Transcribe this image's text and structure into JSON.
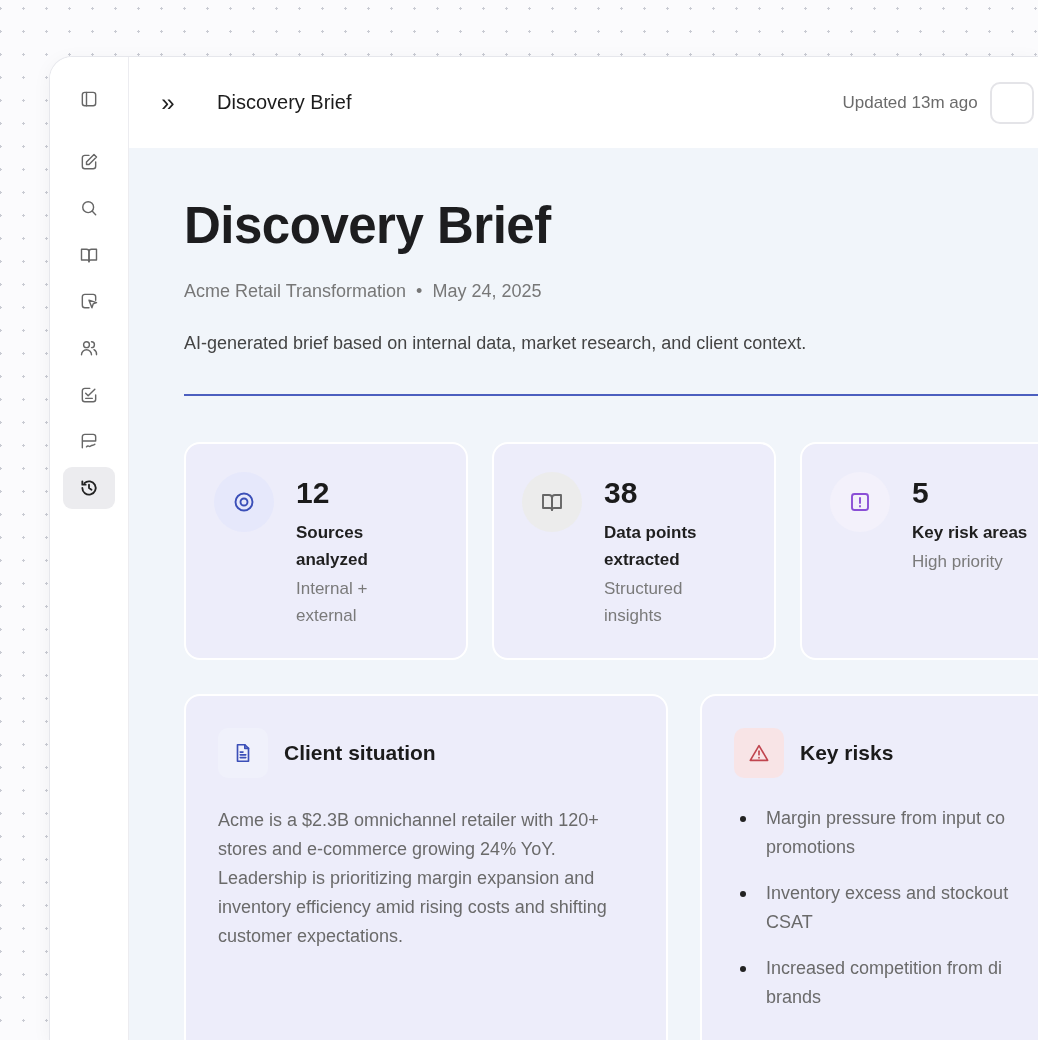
{
  "sidebar": {
    "items": [
      {
        "selected": false
      },
      {
        "selected": false
      },
      {
        "selected": false
      },
      {
        "selected": false
      },
      {
        "selected": false
      },
      {
        "selected": false
      },
      {
        "selected": false
      },
      {
        "selected": false
      },
      {
        "selected": true
      }
    ]
  },
  "header": {
    "expand": "»",
    "title": "Discovery Brief",
    "updated": "Updated 13m ago"
  },
  "brief": {
    "title": "Discovery Brief",
    "project": "Acme Retail Transformation",
    "separator": "•",
    "date": "May 24, 2025",
    "description": "AI-generated brief based on internal data, market research, and client context."
  },
  "stats": [
    {
      "kind": "sources",
      "value": "12",
      "label": "Sources analyzed",
      "note": "Internal + external"
    },
    {
      "kind": "datapoints",
      "value": "38",
      "label": "Data points extracted",
      "note": "Structured insights"
    },
    {
      "kind": "risks",
      "value": "5",
      "label": "Key risk areas",
      "note": "High priority"
    }
  ],
  "sections": [
    {
      "kind": "paragraph",
      "title": "Client situation",
      "text": "Acme is a $2.3B omnichannel retailer with 120+ stores and e-commerce growing 24% YoY. Leadership is prioritizing margin expansion and inventory efficiency amid rising costs and shifting customer expectations."
    },
    {
      "kind": "list",
      "title": "Key risks",
      "items": [
        {
          "lines": [
            "Margin pressure from input co",
            "promotions"
          ]
        },
        {
          "lines": [
            "Inventory excess and stockout",
            "CSAT"
          ]
        },
        {
          "lines": [
            "Increased competition from di",
            "brands"
          ]
        }
      ]
    }
  ]
}
